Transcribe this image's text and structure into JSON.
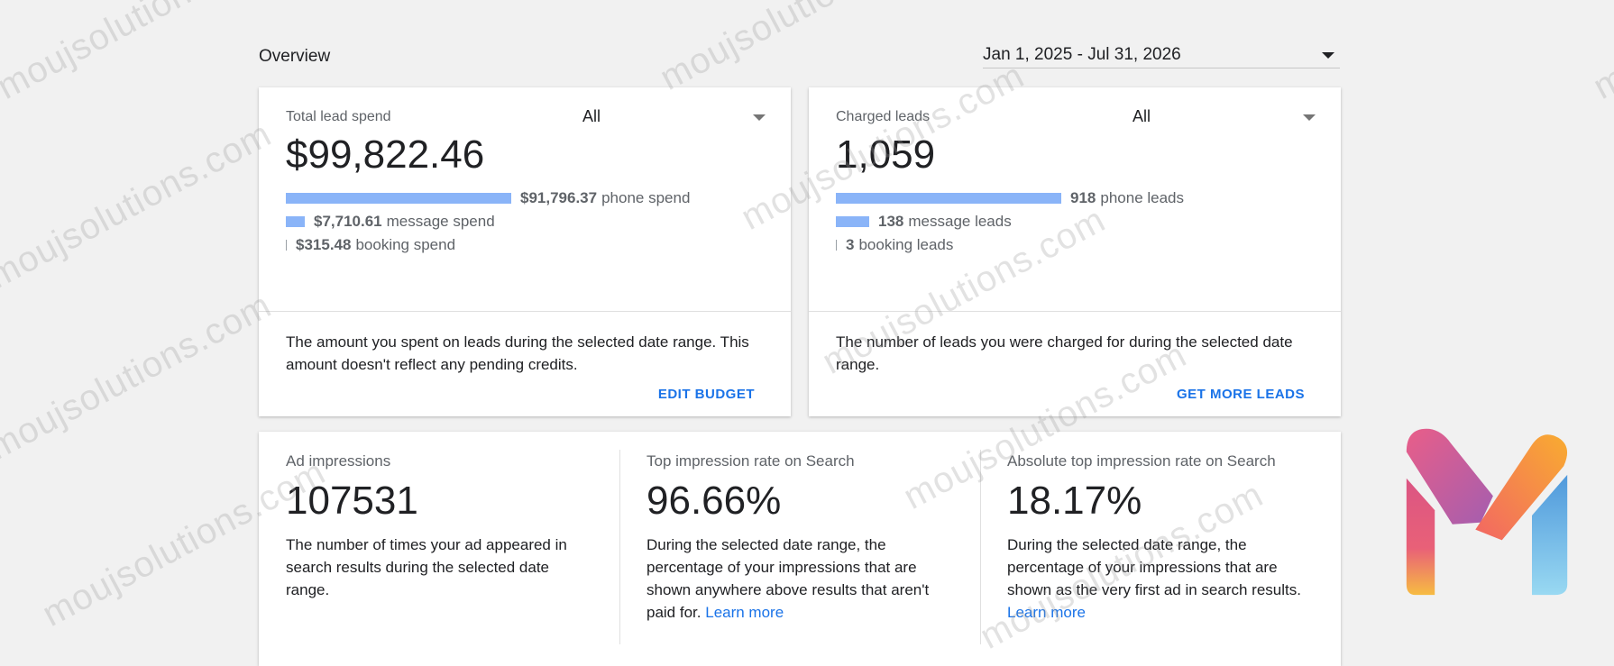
{
  "overview": {
    "title": "Overview"
  },
  "date_range": {
    "value": "Jan 1, 2025 - Jul 31, 2026"
  },
  "lead_spend": {
    "label": "Total lead spend",
    "filter": "All",
    "total": "$99,822.46",
    "rows": [
      {
        "amount": "$91,796.37",
        "text": "phone spend",
        "share": 0.92
      },
      {
        "amount": "$7,710.61",
        "text": "message spend",
        "share": 0.077
      },
      {
        "amount": "$315.48",
        "text": "booking spend",
        "share": 0.003
      }
    ],
    "description": "The amount you spent on leads during the selected date range. This amount doesn't reflect any pending credits.",
    "action": "EDIT BUDGET"
  },
  "charged_leads": {
    "label": "Charged leads",
    "filter": "All",
    "total": "1,059",
    "rows": [
      {
        "amount": "918",
        "text": "phone leads",
        "share": 0.867
      },
      {
        "amount": "138",
        "text": "message leads",
        "share": 0.13
      },
      {
        "amount": "3",
        "text": "booking leads",
        "share": 0.003
      }
    ],
    "description": "The number of leads you were charged for during the selected date range.",
    "action": "GET MORE LEADS"
  },
  "metrics": [
    {
      "label": "Ad impressions",
      "value": "107531",
      "description": "The number of times your ad appeared in search results during the selected date range.",
      "link": ""
    },
    {
      "label": "Top impression rate on Search",
      "value": "96.66%",
      "description": "During the selected date range, the percentage of your impressions that are shown anywhere above results that aren't paid for.",
      "link": "Learn more"
    },
    {
      "label": "Absolute top impression rate on Search",
      "value": "18.17%",
      "description": "During the selected date range, the percentage of your impressions that are shown as the very first ad in search results.",
      "link": "Learn more"
    }
  ],
  "watermark": {
    "text": "moujsolutions.com"
  },
  "colors": {
    "bar": "#8ab4f8",
    "link": "#1a73e8"
  }
}
